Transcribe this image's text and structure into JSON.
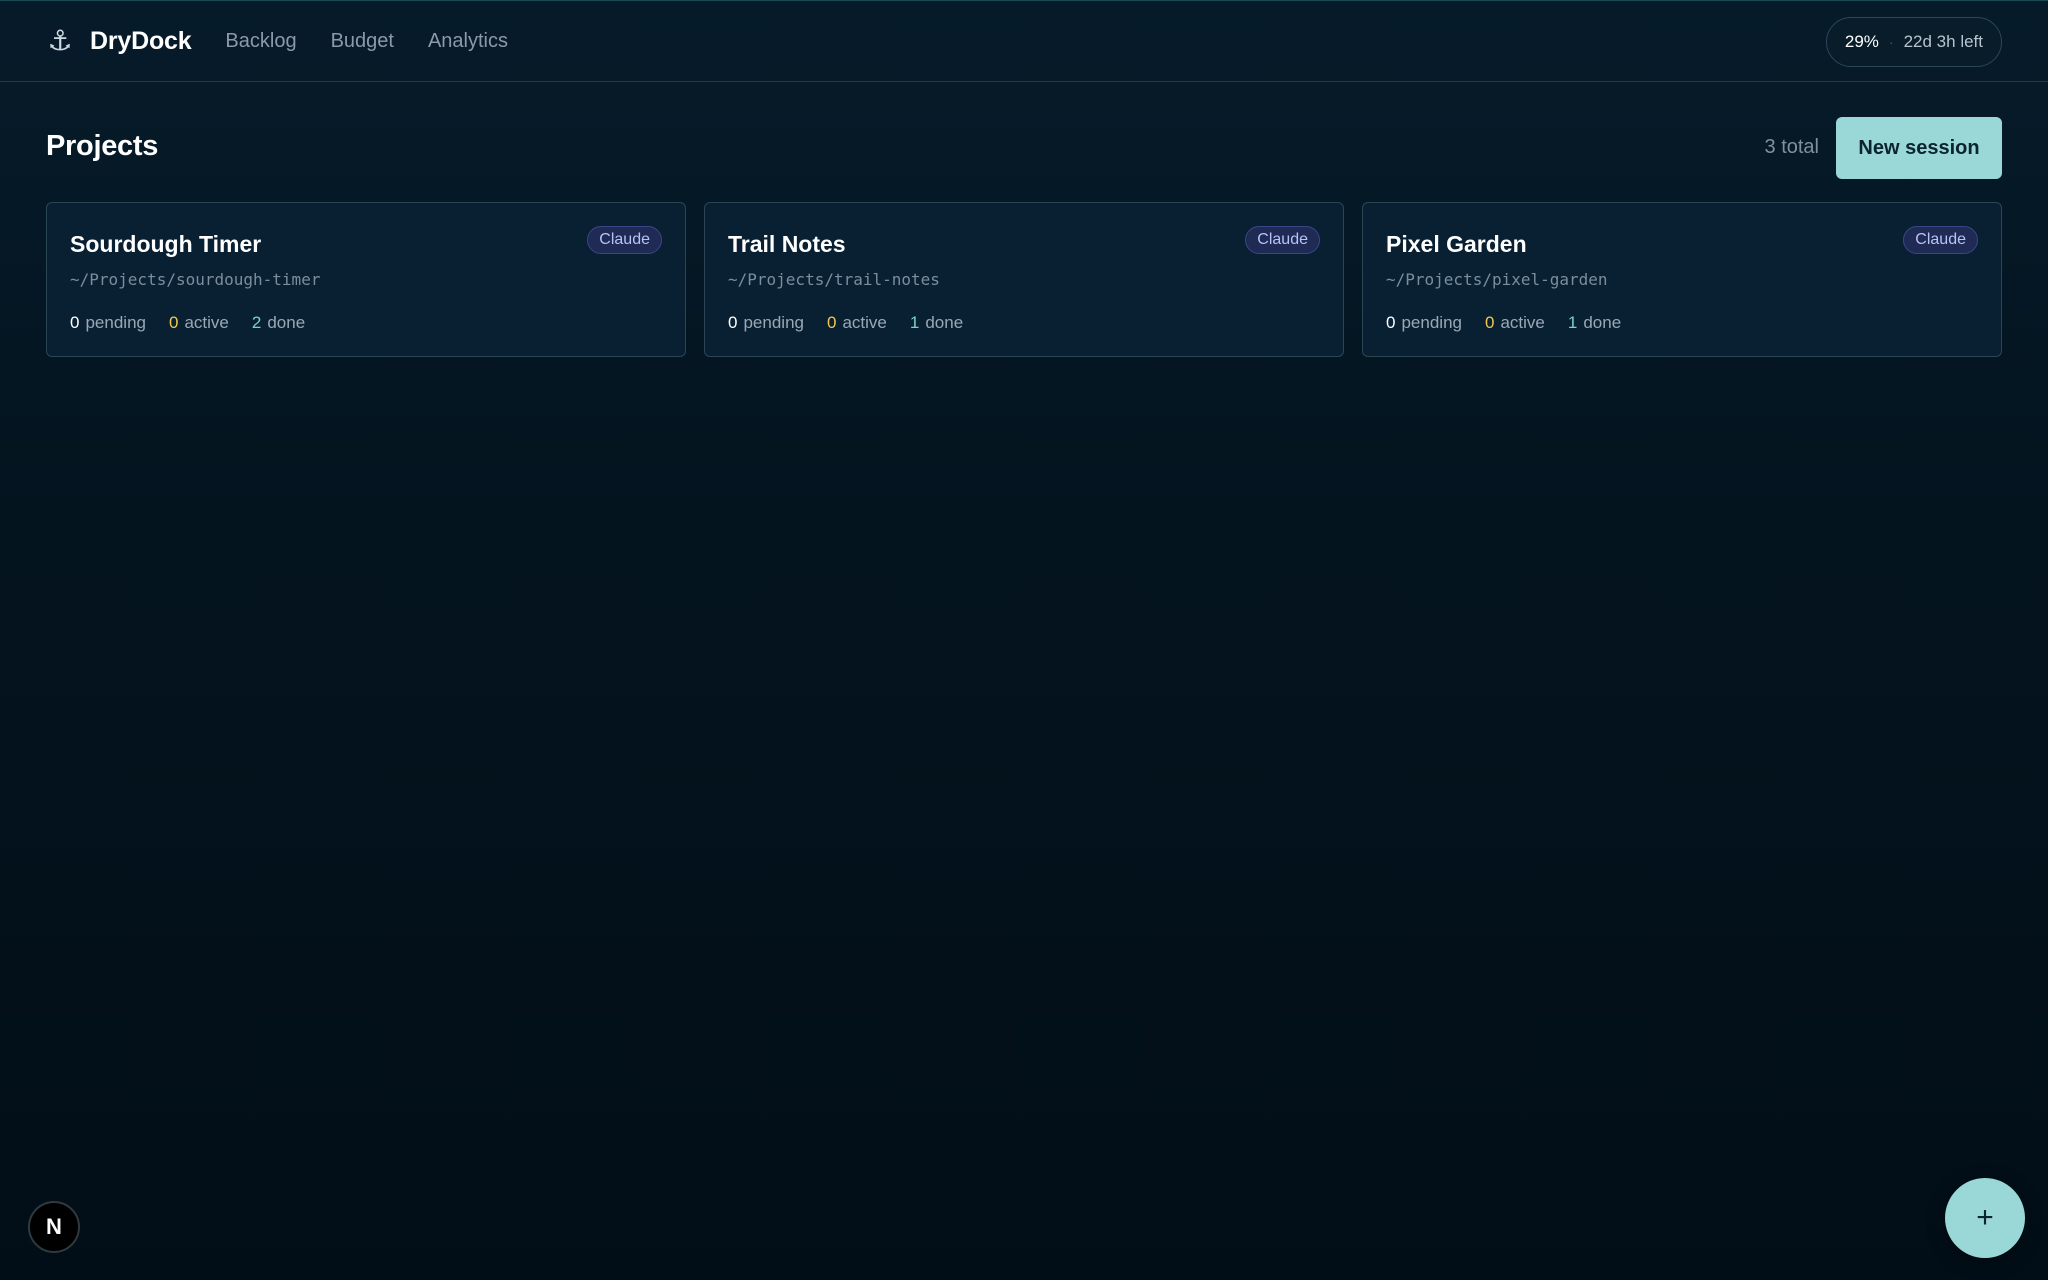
{
  "app": {
    "brand_icon": "⚓",
    "brand_name": "DryDock",
    "nav": [
      "Backlog",
      "Budget",
      "Analytics"
    ],
    "usage": {
      "percent": "29%",
      "separator": "·",
      "time_left": "22d 3h left"
    }
  },
  "page": {
    "title": "Projects",
    "total": "3 total",
    "new_session_label": "New session"
  },
  "projects": [
    {
      "name": "Sourdough Timer",
      "path": "~/Projects/sourdough-timer",
      "badge": "Claude",
      "pending": "0",
      "active": "0",
      "done": "2"
    },
    {
      "name": "Trail Notes",
      "path": "~/Projects/trail-notes",
      "badge": "Claude",
      "pending": "0",
      "active": "0",
      "done": "1"
    },
    {
      "name": "Pixel Garden",
      "path": "~/Projects/pixel-garden",
      "badge": "Claude",
      "pending": "0",
      "active": "0",
      "done": "1"
    }
  ],
  "labels": {
    "pending": "pending",
    "active": "active",
    "done": "done"
  },
  "floating": {
    "n_badge": "N",
    "fab_icon": "+"
  },
  "colors": {
    "accent": "#9ad8d8",
    "active": "#f2c94c",
    "done": "#7fd1c4",
    "badge_bg": "#1f2a55"
  }
}
